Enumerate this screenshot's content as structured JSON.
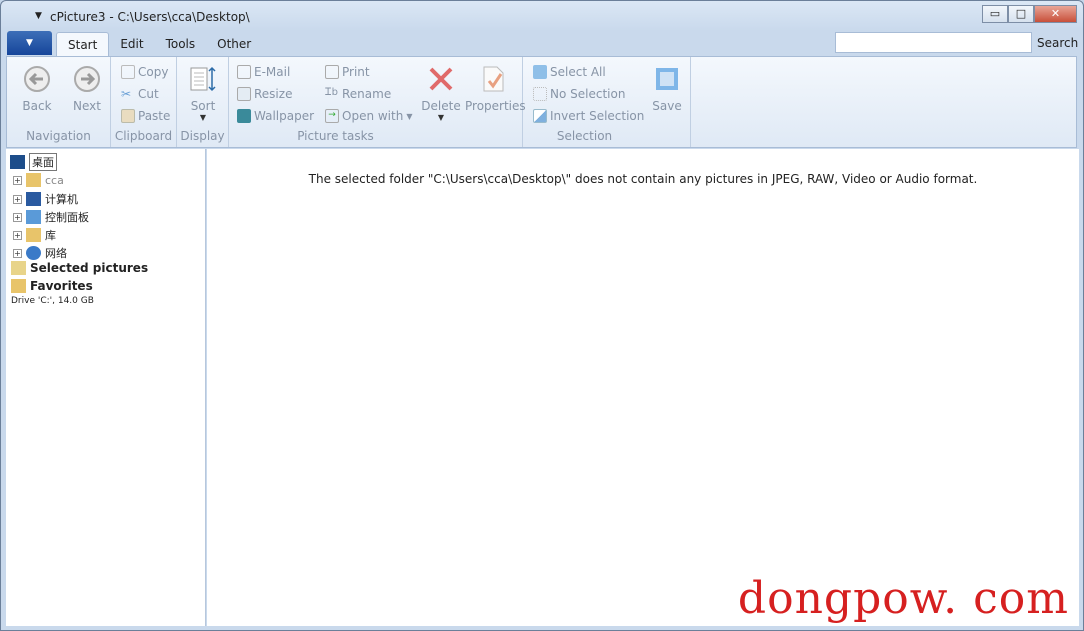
{
  "window": {
    "title": "cPicture3 - C:\\Users\\cca\\Desktop\\",
    "minimize": "▭",
    "maximize": "□",
    "close": "✕"
  },
  "tabs": [
    {
      "label": "Start"
    },
    {
      "label": "Edit"
    },
    {
      "label": "Tools"
    },
    {
      "label": "Other"
    }
  ],
  "search": {
    "label": "Search",
    "value": ""
  },
  "ribbon": {
    "navigation": {
      "label": "Navigation",
      "back": "Back",
      "next": "Next"
    },
    "clipboard": {
      "label": "Clipboard",
      "copy": "Copy",
      "cut": "Cut",
      "paste": "Paste"
    },
    "display": {
      "label": "Display",
      "sort": "Sort"
    },
    "picture_tasks": {
      "label": "Picture tasks",
      "email": "E-Mail",
      "resize": "Resize",
      "wallpaper": "Wallpaper",
      "print": "Print",
      "rename": "Rename",
      "open_with": "Open with",
      "delete": "Delete",
      "properties": "Properties"
    },
    "selection": {
      "label": "Selection",
      "select_all": "Select All",
      "no_selection": "No Selection",
      "invert": "Invert Selection"
    },
    "save": "Save"
  },
  "tree": {
    "root": "桌面",
    "items": [
      "cca",
      "计算机",
      "控制面板",
      "库",
      "网络"
    ],
    "selected_pictures": "Selected pictures",
    "favorites": "Favorites",
    "drive": "Drive 'C:', 14.0 GB"
  },
  "main": {
    "message": "The selected folder \"C:\\Users\\cca\\Desktop\\\" does not contain any pictures in JPEG, RAW, Video or Audio format."
  },
  "watermark": "dongpow. com"
}
